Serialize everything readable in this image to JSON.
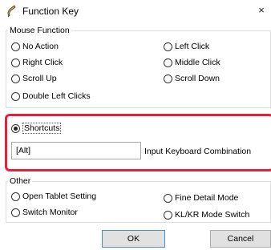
{
  "window": {
    "title": "Function Key",
    "close_glyph": "×"
  },
  "mouse_group": {
    "label": "Mouse Function",
    "options": {
      "no_action": "No Action",
      "left_click": "Left Click",
      "right_click": "Right Click",
      "middle_click": "Middle Click",
      "scroll_up": "Scroll Up",
      "scroll_down": "Scroll Down",
      "double_left_clicks": "Double Left Clicks"
    }
  },
  "shortcuts": {
    "label": "Shortcuts",
    "selected": true,
    "input_value": "[Alt]",
    "input_label": "Input Keyboard Combination",
    "highlight_color": "#e8203a"
  },
  "other_group": {
    "label": "Other",
    "options": {
      "open_tablet_setting": "Open Tablet Setting",
      "fine_detail_mode": "Fine Detail Mode",
      "switch_monitor": "Switch Monitor",
      "kl_kr_mode_switch": "KL/KR Mode Switch"
    }
  },
  "buttons": {
    "ok": "OK",
    "cancel": "Cancel"
  },
  "icons": {
    "app": "pen-icon",
    "close": "close-icon"
  }
}
